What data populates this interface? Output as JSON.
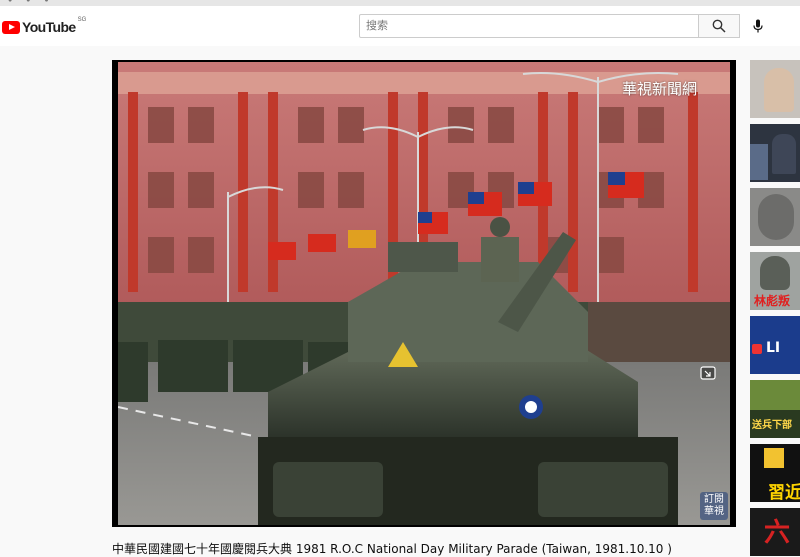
{
  "header": {
    "logo_text": "YouTube",
    "region": "SG",
    "search": {
      "placeholder": "搜索",
      "value": ""
    },
    "icons": {
      "search": "search-icon",
      "mic": "microphone-icon"
    }
  },
  "video": {
    "watermark": "華視新聞網",
    "corner_logo_line1": "訂閱",
    "corner_logo_line2": "華視",
    "title": "中華民國建國七十年國慶閱兵大典 1981 R.O.C National Day Military Parade (Taiwan, 1981.10.10 )"
  },
  "sidebar": {
    "items": [
      {
        "overlay": ""
      },
      {
        "overlay": ""
      },
      {
        "overlay": ""
      },
      {
        "overlay": "林彪叛"
      },
      {
        "overlay": "LI"
      },
      {
        "overlay": "送兵下部"
      },
      {
        "overlay": "習近"
      },
      {
        "overlay": "六"
      }
    ]
  },
  "colors": {
    "brand_red": "#ff0000",
    "background": "#f9f9f9"
  }
}
